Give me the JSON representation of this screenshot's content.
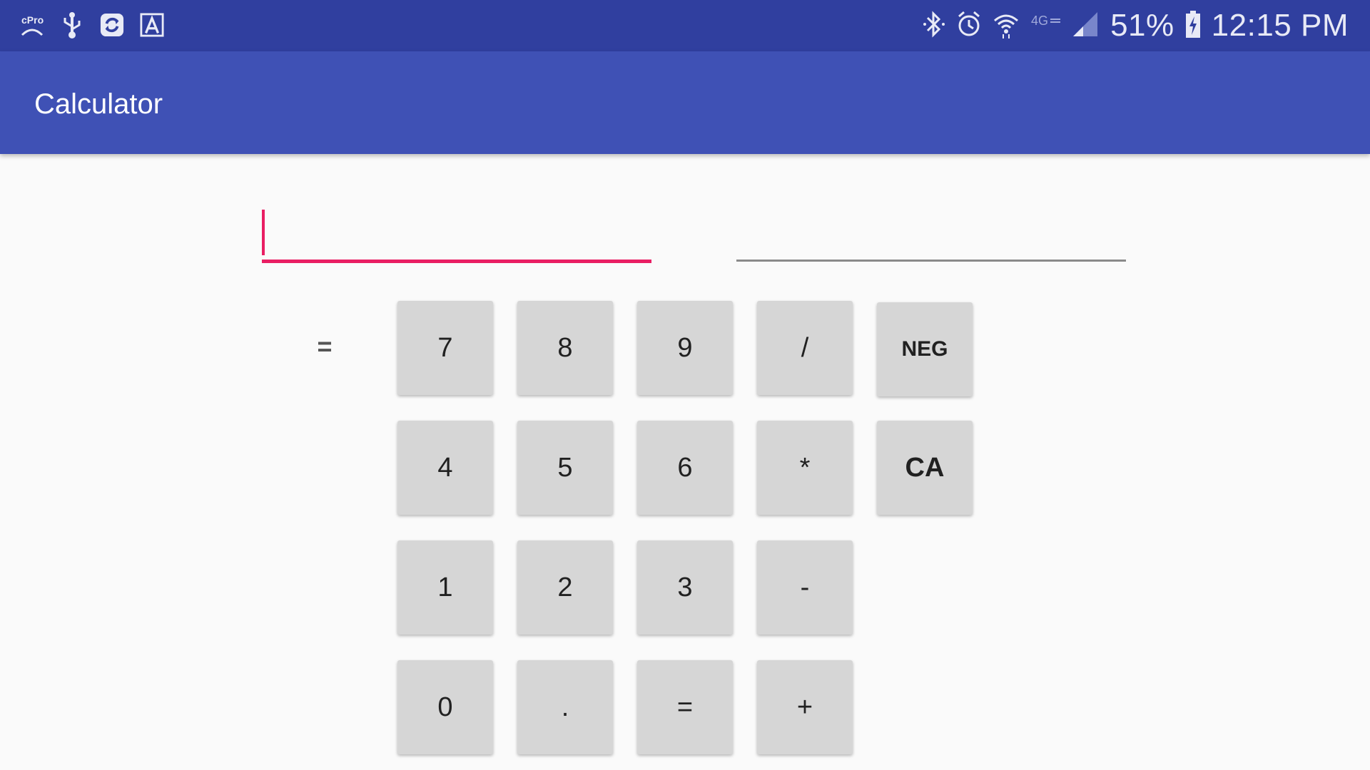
{
  "status_bar": {
    "left_icons": [
      "cpro-icon",
      "usb-icon",
      "sync-icon",
      "font-icon"
    ],
    "right_icons": [
      "bluetooth-icon",
      "alarm-icon",
      "wifi-icon",
      "4g-icon",
      "signal-icon"
    ],
    "battery": "51%",
    "time": "12:15 PM",
    "cpro_text": "cPro",
    "network_text": "4G"
  },
  "app_bar": {
    "title": "Calculator"
  },
  "inputs": {
    "number_field": {
      "value": ""
    },
    "result_field": {
      "value": ""
    }
  },
  "operation_label": "=",
  "keypad": {
    "row1": [
      "7",
      "8",
      "9",
      "/",
      "NEG"
    ],
    "row2": [
      "4",
      "5",
      "6",
      "*",
      "CA"
    ],
    "row3": [
      "1",
      "2",
      "3",
      "-"
    ],
    "row4": [
      "0",
      ".",
      "=",
      "+"
    ]
  },
  "colors": {
    "status_bar": "#303f9f",
    "app_bar": "#3f51b5",
    "accent": "#e91e63",
    "button": "#d6d6d6",
    "background": "#fafafa"
  }
}
